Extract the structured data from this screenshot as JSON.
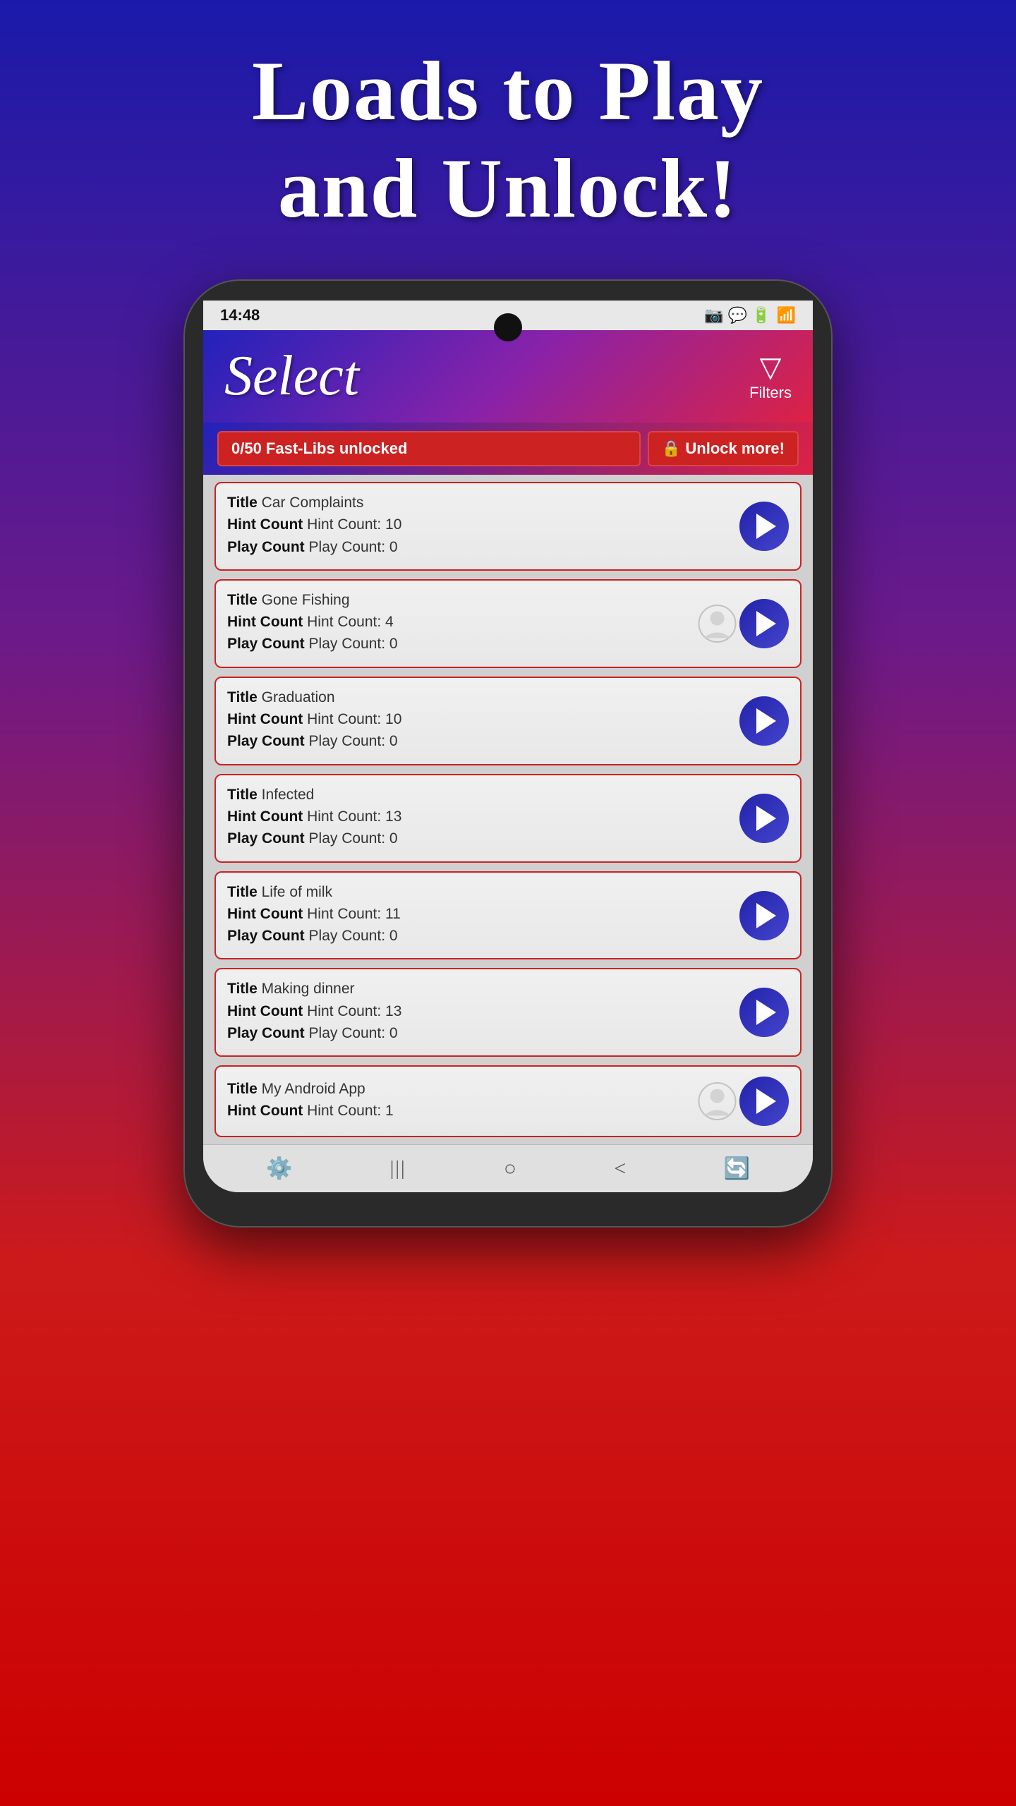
{
  "hero": {
    "title": "Loads to Play\nand Unlock!"
  },
  "statusBar": {
    "time": "14:48",
    "icons": "📷 💬 🔋"
  },
  "header": {
    "title": "Select",
    "filterLabel": "Filters"
  },
  "unlockBar": {
    "fastLibsBadge": "0/50 Fast-Libs unlocked",
    "unlockMoreBtn": "🔒 Unlock more!"
  },
  "items": [
    {
      "id": 1,
      "title": "Car Complaints",
      "titleLabel": "Title",
      "hintCount": "10",
      "hintLabel": "Hint Count",
      "hintFullText": "Hint Count: 10",
      "playCount": "0",
      "playLabel": "Play Count",
      "playFullText": "Play Count: 0",
      "userCreated": false
    },
    {
      "id": 2,
      "title": "Gone Fishing",
      "titleLabel": "Title",
      "hintCount": "4",
      "hintLabel": "Hint Count",
      "hintFullText": "Hint Count: 4",
      "playCount": "0",
      "playLabel": "Play Count",
      "playFullText": "Play Count: 0",
      "userCreated": true
    },
    {
      "id": 3,
      "title": "Graduation",
      "titleLabel": "Title",
      "hintCount": "10",
      "hintLabel": "Hint Count",
      "hintFullText": "Hint Count: 10",
      "playCount": "0",
      "playLabel": "Play Count",
      "playFullText": "Play Count: 0",
      "userCreated": false
    },
    {
      "id": 4,
      "title": "Infected",
      "titleLabel": "Title",
      "hintCount": "13",
      "hintLabel": "Hint Count",
      "hintFullText": "Hint Count: 13",
      "playCount": "0",
      "playLabel": "Play Count",
      "playFullText": "Play Count: 0",
      "userCreated": false
    },
    {
      "id": 5,
      "title": "Life of milk",
      "titleLabel": "Title",
      "hintCount": "11",
      "hintLabel": "Hint Count",
      "hintFullText": "Hint Count: 11",
      "playCount": "0",
      "playLabel": "Play Count",
      "playFullText": "Play Count: 0",
      "userCreated": false
    },
    {
      "id": 6,
      "title": "Making dinner",
      "titleLabel": "Title",
      "hintCount": "13",
      "hintLabel": "Hint Count",
      "hintFullText": "Hint Count: 13",
      "playCount": "0",
      "playLabel": "Play Count",
      "playFullText": "Play Count: 0",
      "userCreated": false
    },
    {
      "id": 7,
      "title": "My Android App",
      "titleLabel": "Title",
      "hintCount": "1",
      "hintLabel": "Hint Count",
      "hintFullText": "Hint Count: 1",
      "playCount": null,
      "playLabel": "Play Count",
      "playFullText": null,
      "userCreated": true,
      "partial": true
    }
  ],
  "navBar": {
    "settingsIcon": "⚙",
    "homeIcon": "|||",
    "backIcon": "<",
    "recentsIcon": "○"
  }
}
